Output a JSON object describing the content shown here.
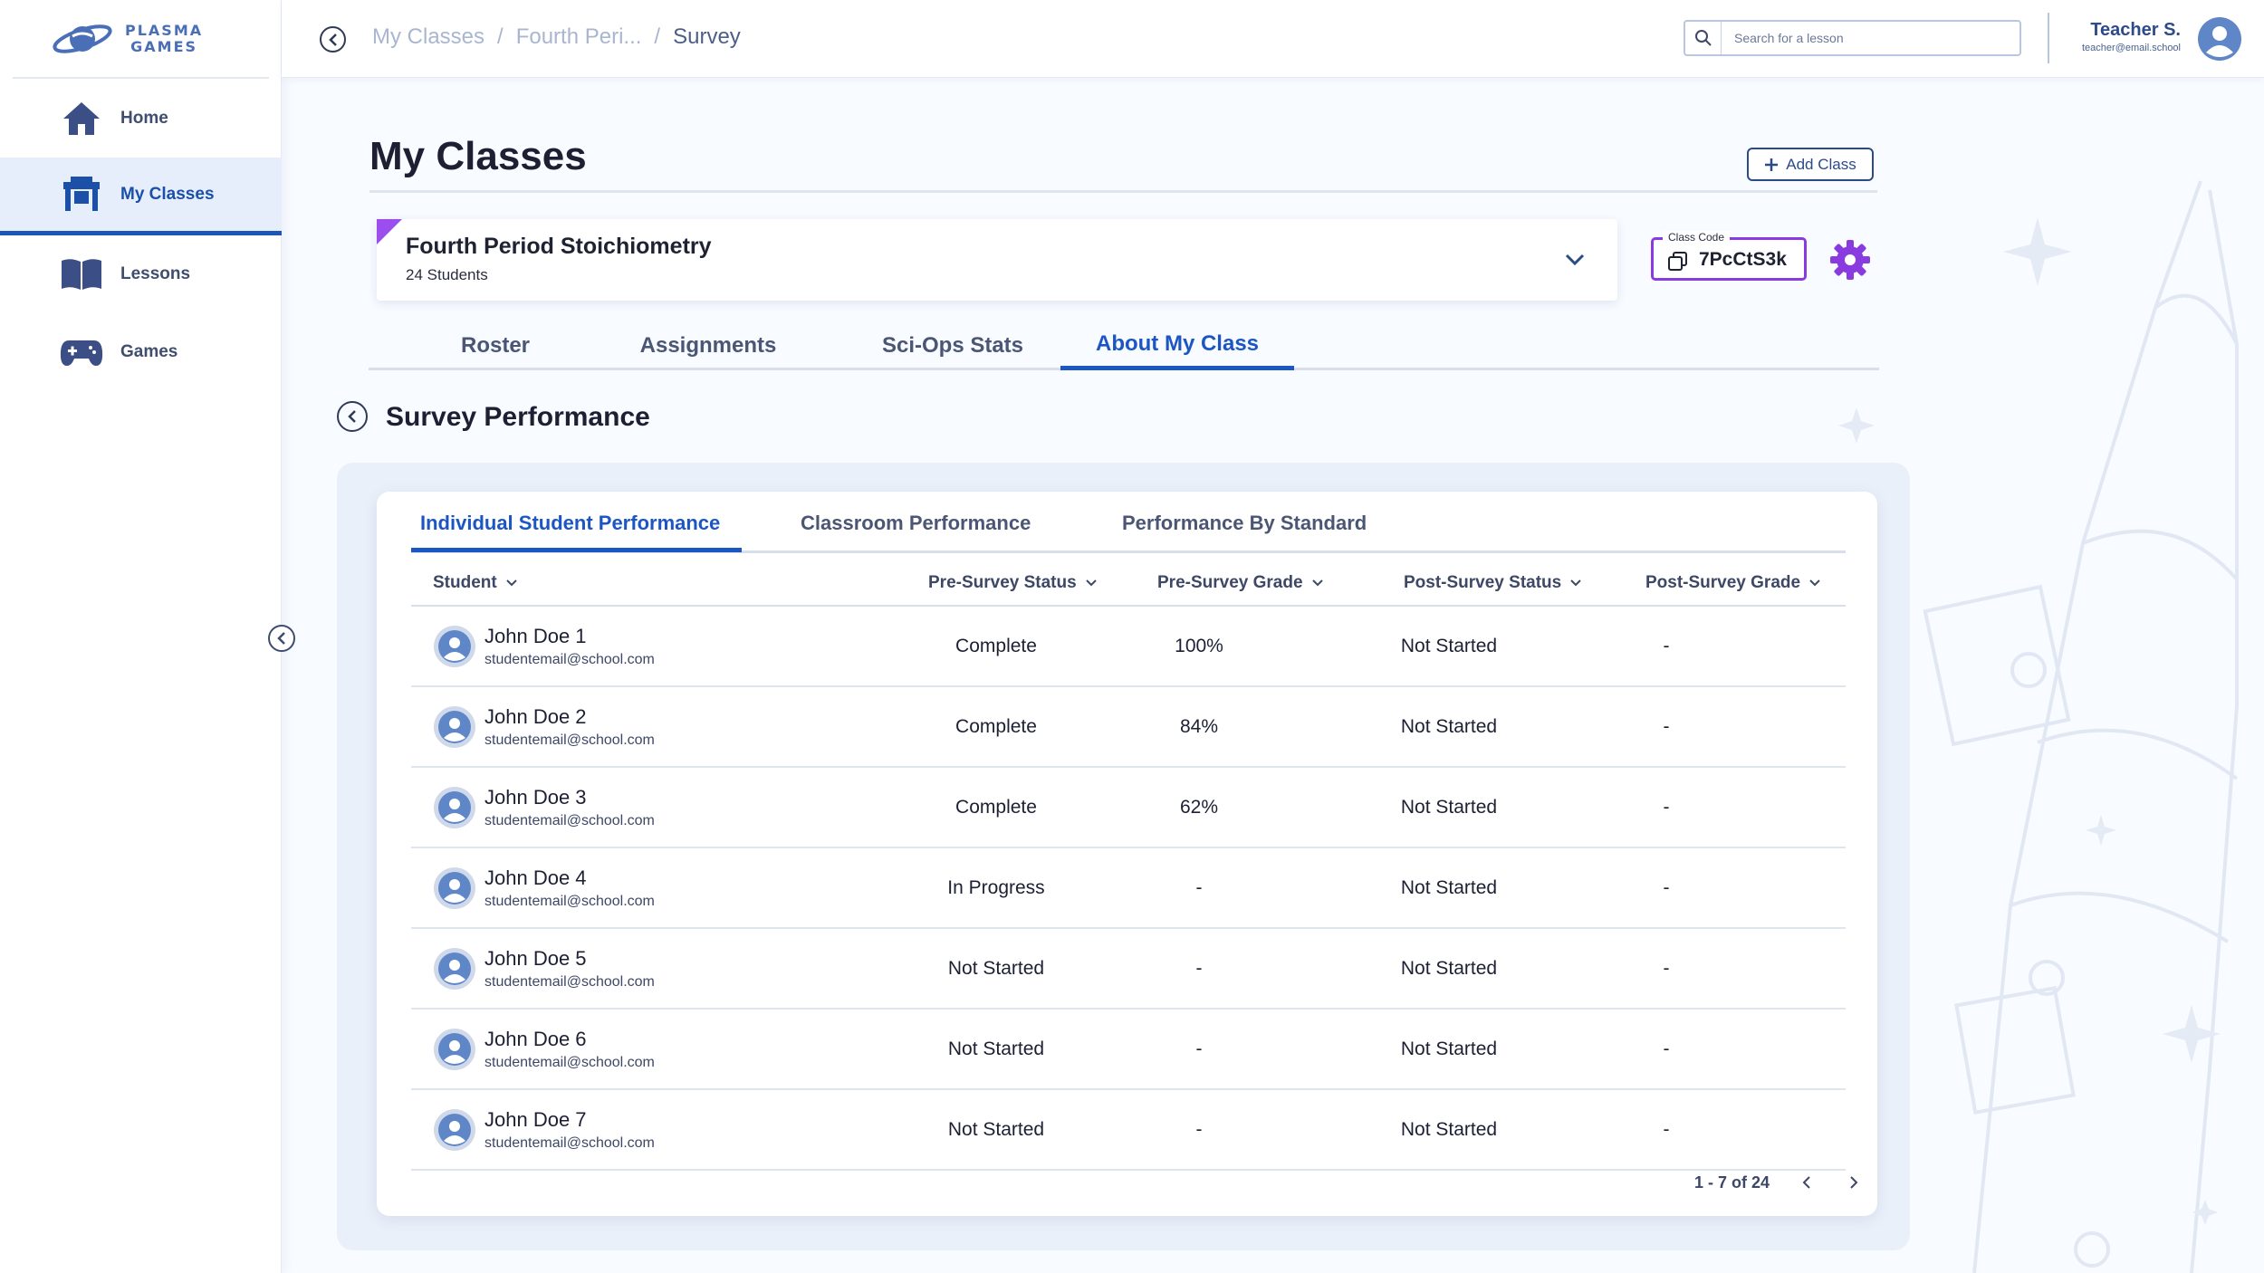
{
  "brand": {
    "line1": "PLASMA",
    "line2": "GAMES"
  },
  "sidebar": {
    "items": [
      {
        "label": "Home",
        "icon": "home-icon"
      },
      {
        "label": "My Classes",
        "icon": "desk-icon",
        "active": true
      },
      {
        "label": "Lessons",
        "icon": "book-icon"
      },
      {
        "label": "Games",
        "icon": "gamepad-icon"
      }
    ]
  },
  "breadcrumb": {
    "items": [
      "My Classes",
      "Fourth Peri...",
      "Survey"
    ],
    "separator": "/"
  },
  "search": {
    "placeholder": "Search for a lesson",
    "value": ""
  },
  "user": {
    "name": "Teacher S.",
    "email": "teacher@email.school"
  },
  "page": {
    "title": "My Classes",
    "add_class_label": "Add Class"
  },
  "class": {
    "name": "Fourth Period Stoichiometry",
    "students": "24 Students",
    "code_label": "Class Code",
    "code": "7PcCtS3k",
    "accent_color": "#9b4dee"
  },
  "tabs": [
    "Roster",
    "Assignments",
    "Sci-Ops Stats",
    "About My Class"
  ],
  "active_tab": "About My Class",
  "survey": {
    "title": "Survey Performance",
    "subtabs": [
      "Individual Student Performance",
      "Classroom Performance",
      "Performance By Standard"
    ],
    "active_subtab": "Individual Student Performance",
    "columns": [
      "Student",
      "Pre-Survey Status",
      "Pre-Survey Grade",
      "Post-Survey Status",
      "Post-Survey Grade"
    ],
    "rows": [
      {
        "name": "John Doe 1",
        "email": "studentemail@school.com",
        "pre_status": "Complete",
        "pre_grade": "100%",
        "post_status": "Not Started",
        "post_grade": "-"
      },
      {
        "name": "John Doe 2",
        "email": "studentemail@school.com",
        "pre_status": "Complete",
        "pre_grade": "84%",
        "post_status": "Not Started",
        "post_grade": "-"
      },
      {
        "name": "John Doe 3",
        "email": "studentemail@school.com",
        "pre_status": "Complete",
        "pre_grade": "62%",
        "post_status": "Not Started",
        "post_grade": "-"
      },
      {
        "name": "John Doe 4",
        "email": "studentemail@school.com",
        "pre_status": "In Progress",
        "pre_grade": "-",
        "post_status": "Not Started",
        "post_grade": "-"
      },
      {
        "name": "John Doe 5",
        "email": "studentemail@school.com",
        "pre_status": "Not Started",
        "pre_grade": "-",
        "post_status": "Not Started",
        "post_grade": "-"
      },
      {
        "name": "John Doe 6",
        "email": "studentemail@school.com",
        "pre_status": "Not Started",
        "pre_grade": "-",
        "post_status": "Not Started",
        "post_grade": "-"
      },
      {
        "name": "John Doe 7",
        "email": "studentemail@school.com",
        "pre_status": "Not Started",
        "pre_grade": "-",
        "post_status": "Not Started",
        "post_grade": "-"
      }
    ],
    "pagination": "1 - 7 of 24"
  },
  "colors": {
    "primary": "#1c56c4",
    "accent": "#8a3be0",
    "sidebar_active_bg": "#e6eefb"
  }
}
